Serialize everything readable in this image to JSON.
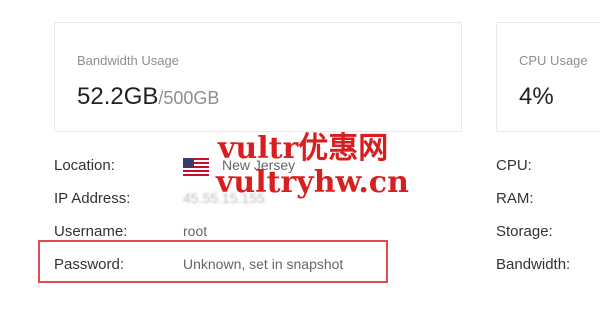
{
  "bandwidth_card": {
    "title": "Bandwidth Usage",
    "used": "52.2GB",
    "total": "/500GB"
  },
  "cpu_card": {
    "title": "CPU Usage",
    "value": "4%"
  },
  "info": {
    "location_label": "Location:",
    "location_value": "New Jersey",
    "location_icon": "us-flag-icon",
    "ip_label": "IP Address:",
    "ip_value": "45.55.15.155",
    "username_label": "Username:",
    "username_value": "root",
    "password_label": "Password:",
    "password_value": "Unknown, set in snapshot"
  },
  "right_info": {
    "cpu_label": "CPU:",
    "ram_label": "RAM:",
    "storage_label": "Storage:",
    "bandwidth_label": "Bandwidth:"
  },
  "watermark": {
    "line1": "vultr优惠网",
    "line2": "vultryhw.cn"
  },
  "colors": {
    "highlight": "#e14b4b",
    "watermark": "#d81e1e"
  }
}
